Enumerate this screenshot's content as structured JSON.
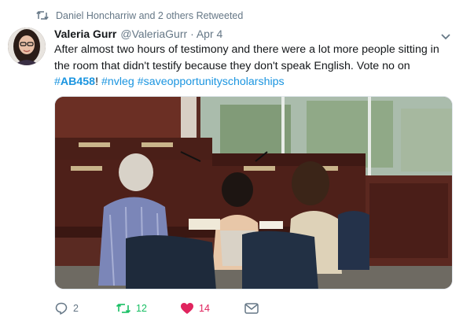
{
  "retweet_context": {
    "text": "Daniel Honcharriw and 2 others Retweeted",
    "icon": "retweet-icon"
  },
  "tweet": {
    "author_name": "Valeria Gurr",
    "handle": "@ValeriaGurr",
    "separator": "·",
    "timestamp": "Apr 4",
    "text_main": "After almost two hours of testimony and there were a lot more people sitting in the room that didn't testify because they don't speak English. Vote no on",
    "hashtag_1_symbol": "#",
    "hashtag_1_tag": "AB458",
    "exclamation": "!",
    "hashtag_2": "#nvleg",
    "hashtag_3": "#saveopportunityscholarships"
  },
  "actions": {
    "reply_count": "2",
    "retweet_count": "12",
    "like_count": "14"
  },
  "colors": {
    "link": "#1b95e0",
    "muted": "#657786",
    "retweet_green": "#17bf63",
    "like_red": "#e0245e"
  }
}
